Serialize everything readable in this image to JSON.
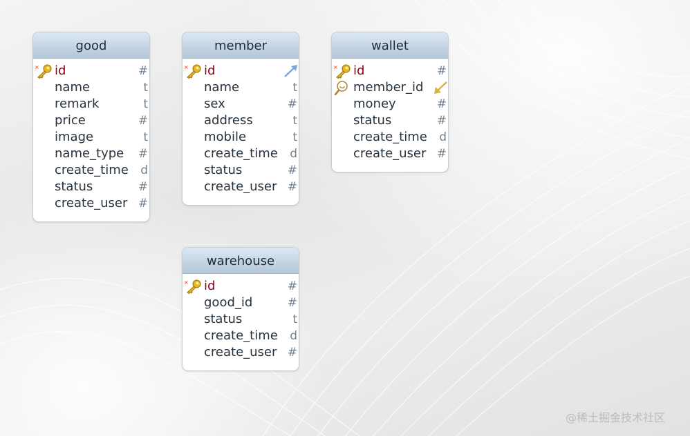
{
  "tables": {
    "good": {
      "title": "good",
      "rows": [
        {
          "name": "id",
          "type": "#"
        },
        {
          "name": "name",
          "type": "t"
        },
        {
          "name": "remark",
          "type": "t"
        },
        {
          "name": "price",
          "type": "#"
        },
        {
          "name": "image",
          "type": "t"
        },
        {
          "name": "name_type",
          "type": "#"
        },
        {
          "name": "create_time",
          "type": "d"
        },
        {
          "name": "status",
          "type": "#"
        },
        {
          "name": "create_user",
          "type": "#"
        }
      ]
    },
    "member": {
      "title": "member",
      "rows": [
        {
          "name": "id",
          "type": ""
        },
        {
          "name": "name",
          "type": "t"
        },
        {
          "name": "sex",
          "type": "#"
        },
        {
          "name": "address",
          "type": "t"
        },
        {
          "name": "mobile",
          "type": "t"
        },
        {
          "name": "create_time",
          "type": "d"
        },
        {
          "name": "status",
          "type": "#"
        },
        {
          "name": "create_user",
          "type": "#"
        }
      ]
    },
    "wallet": {
      "title": "wallet",
      "rows": [
        {
          "name": "id",
          "type": "#"
        },
        {
          "name": "member_id",
          "type": ""
        },
        {
          "name": "money",
          "type": "#"
        },
        {
          "name": "status",
          "type": "#"
        },
        {
          "name": "create_time",
          "type": "d"
        },
        {
          "name": "create_user",
          "type": "#"
        }
      ]
    },
    "warehouse": {
      "title": "warehouse",
      "rows": [
        {
          "name": "id",
          "type": "#"
        },
        {
          "name": "good_id",
          "type": "#"
        },
        {
          "name": "status",
          "type": "t"
        },
        {
          "name": "create_time",
          "type": "d"
        },
        {
          "name": "create_user",
          "type": "#"
        }
      ]
    }
  },
  "icons": {
    "primary_key": "key-icon",
    "index": "magnifier-index-icon",
    "relation_out": "relation-arrow-out-icon",
    "relation_in": "relation-arrow-in-icon"
  },
  "colors": {
    "header": "#c8d6e5",
    "pk_text": "#8b0012",
    "relation_out": "#7aa6dd",
    "relation_in": "#d4b33a"
  },
  "watermark": "@稀土掘金技术社区"
}
